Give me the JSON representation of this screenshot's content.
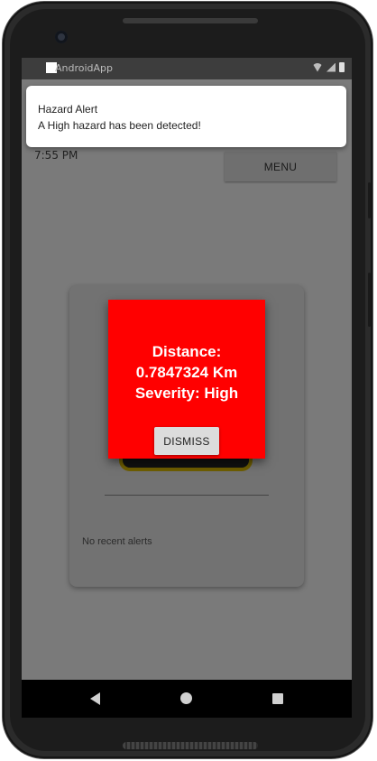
{
  "status_bar": {
    "app_name": "AndroidApp",
    "icons": [
      "wifi-icon",
      "signal-icon",
      "battery-icon"
    ]
  },
  "notification": {
    "title": "Hazard Alert",
    "body": "A High hazard has been detected!"
  },
  "header": {
    "time": "7:55 PM",
    "menu_label": "MENU"
  },
  "card": {
    "recent_alerts_text": "No recent alerts"
  },
  "dialog": {
    "line1": "Distance:",
    "line2": "0.7847324 Km",
    "line3": "Severity: High",
    "dismiss_label": "DISMISS",
    "background_color": "#ff0000"
  },
  "nav_bar": {
    "icons": [
      "back-icon",
      "home-icon",
      "recents-icon"
    ]
  }
}
